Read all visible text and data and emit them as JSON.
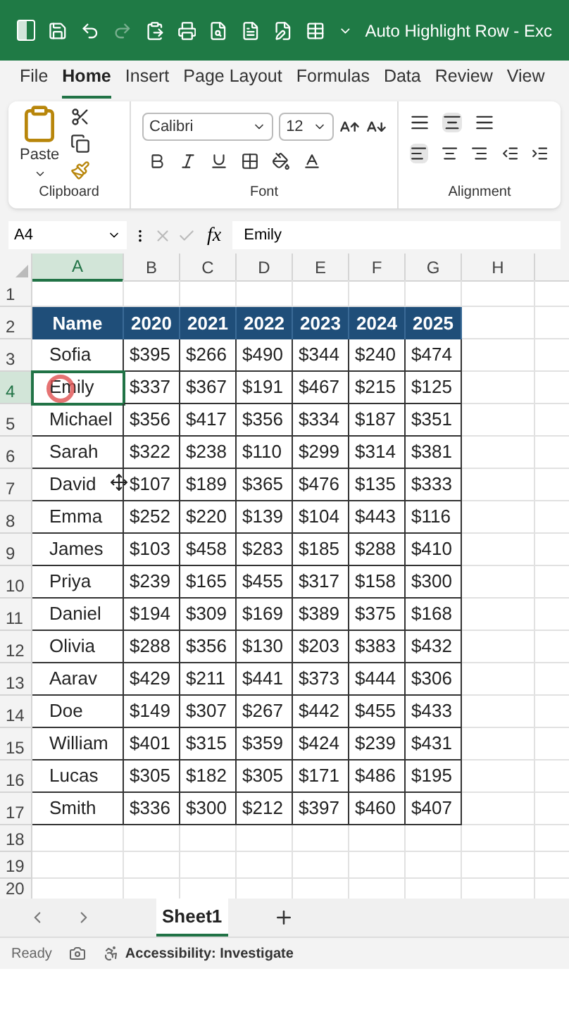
{
  "window": {
    "title": "Auto Highlight Row - Exc"
  },
  "menu_tabs": [
    {
      "label": "File",
      "selected": false
    },
    {
      "label": "Home",
      "selected": true
    },
    {
      "label": "Insert",
      "selected": false
    },
    {
      "label": "Page Layout",
      "selected": false
    },
    {
      "label": "Formulas",
      "selected": false
    },
    {
      "label": "Data",
      "selected": false
    },
    {
      "label": "Review",
      "selected": false
    },
    {
      "label": "View",
      "selected": false
    }
  ],
  "ribbon": {
    "clipboard": {
      "paste_label": "Paste",
      "group_label": "Clipboard"
    },
    "font": {
      "font_name": "Calibri",
      "font_size": "12",
      "group_label": "Font"
    },
    "alignment": {
      "group_label": "Alignment"
    }
  },
  "formula_bar": {
    "name_box": "A4",
    "fx": "fx",
    "value": "Emily"
  },
  "grid": {
    "column_headers": [
      {
        "label": "A",
        "selected": true
      },
      {
        "label": "B",
        "selected": false
      },
      {
        "label": "C",
        "selected": false
      },
      {
        "label": "D",
        "selected": false
      },
      {
        "label": "E",
        "selected": false
      },
      {
        "label": "F",
        "selected": false
      },
      {
        "label": "G",
        "selected": false
      },
      {
        "label": "H",
        "selected": false
      }
    ],
    "rows": [
      {
        "number": "1",
        "kind": "empty",
        "selected": false
      },
      {
        "number": "2",
        "kind": "header",
        "selected": false,
        "cells": [
          "Name",
          "2020",
          "2021",
          "2022",
          "2023",
          "2024",
          "2025"
        ]
      },
      {
        "number": "3",
        "kind": "data",
        "selected": false,
        "cells": [
          "Sofia",
          "$395",
          "$266",
          "$490",
          "$344",
          "$240",
          "$474"
        ]
      },
      {
        "number": "4",
        "kind": "data",
        "selected": true,
        "cells": [
          "Emily",
          "$337",
          "$367",
          "$191",
          "$467",
          "$215",
          "$125"
        ]
      },
      {
        "number": "5",
        "kind": "data",
        "selected": false,
        "cells": [
          "Michael",
          "$356",
          "$417",
          "$356",
          "$334",
          "$187",
          "$351"
        ]
      },
      {
        "number": "6",
        "kind": "data",
        "selected": false,
        "cells": [
          "Sarah",
          "$322",
          "$238",
          "$110",
          "$299",
          "$314",
          "$381"
        ]
      },
      {
        "number": "7",
        "kind": "data",
        "selected": false,
        "cells": [
          "David",
          "$107",
          "$189",
          "$365",
          "$476",
          "$135",
          "$333"
        ]
      },
      {
        "number": "8",
        "kind": "data",
        "selected": false,
        "cells": [
          "Emma",
          "$252",
          "$220",
          "$139",
          "$104",
          "$443",
          "$116"
        ]
      },
      {
        "number": "9",
        "kind": "data",
        "selected": false,
        "cells": [
          "James",
          "$103",
          "$458",
          "$283",
          "$185",
          "$288",
          "$410"
        ]
      },
      {
        "number": "10",
        "kind": "data",
        "selected": false,
        "cells": [
          "Priya",
          "$239",
          "$165",
          "$455",
          "$317",
          "$158",
          "$300"
        ]
      },
      {
        "number": "11",
        "kind": "data",
        "selected": false,
        "cells": [
          "Daniel",
          "$194",
          "$309",
          "$169",
          "$389",
          "$375",
          "$168"
        ]
      },
      {
        "number": "12",
        "kind": "data",
        "selected": false,
        "cells": [
          "Olivia",
          "$288",
          "$356",
          "$130",
          "$203",
          "$383",
          "$432"
        ]
      },
      {
        "number": "13",
        "kind": "data",
        "selected": false,
        "cells": [
          "Aarav",
          "$429",
          "$211",
          "$441",
          "$373",
          "$444",
          "$306"
        ]
      },
      {
        "number": "14",
        "kind": "data",
        "selected": false,
        "cells": [
          "Doe",
          "$149",
          "$307",
          "$267",
          "$442",
          "$455",
          "$433"
        ]
      },
      {
        "number": "15",
        "kind": "data",
        "selected": false,
        "cells": [
          "William",
          "$401",
          "$315",
          "$359",
          "$424",
          "$239",
          "$431"
        ]
      },
      {
        "number": "16",
        "kind": "data",
        "selected": false,
        "cells": [
          "Lucas",
          "$305",
          "$182",
          "$305",
          "$171",
          "$486",
          "$195"
        ]
      },
      {
        "number": "17",
        "kind": "data",
        "selected": false,
        "cells": [
          "Smith",
          "$336",
          "$300",
          "$212",
          "$397",
          "$460",
          "$407"
        ]
      },
      {
        "number": "18",
        "kind": "empty",
        "selected": false
      },
      {
        "number": "19",
        "kind": "empty",
        "selected": false
      },
      {
        "number": "20",
        "kind": "empty",
        "selected": false
      }
    ]
  },
  "sheet_tabs": [
    {
      "label": "Sheet1",
      "selected": true
    }
  ],
  "status_bar": {
    "mode": "Ready",
    "accessibility": "Accessibility: Investigate"
  }
}
